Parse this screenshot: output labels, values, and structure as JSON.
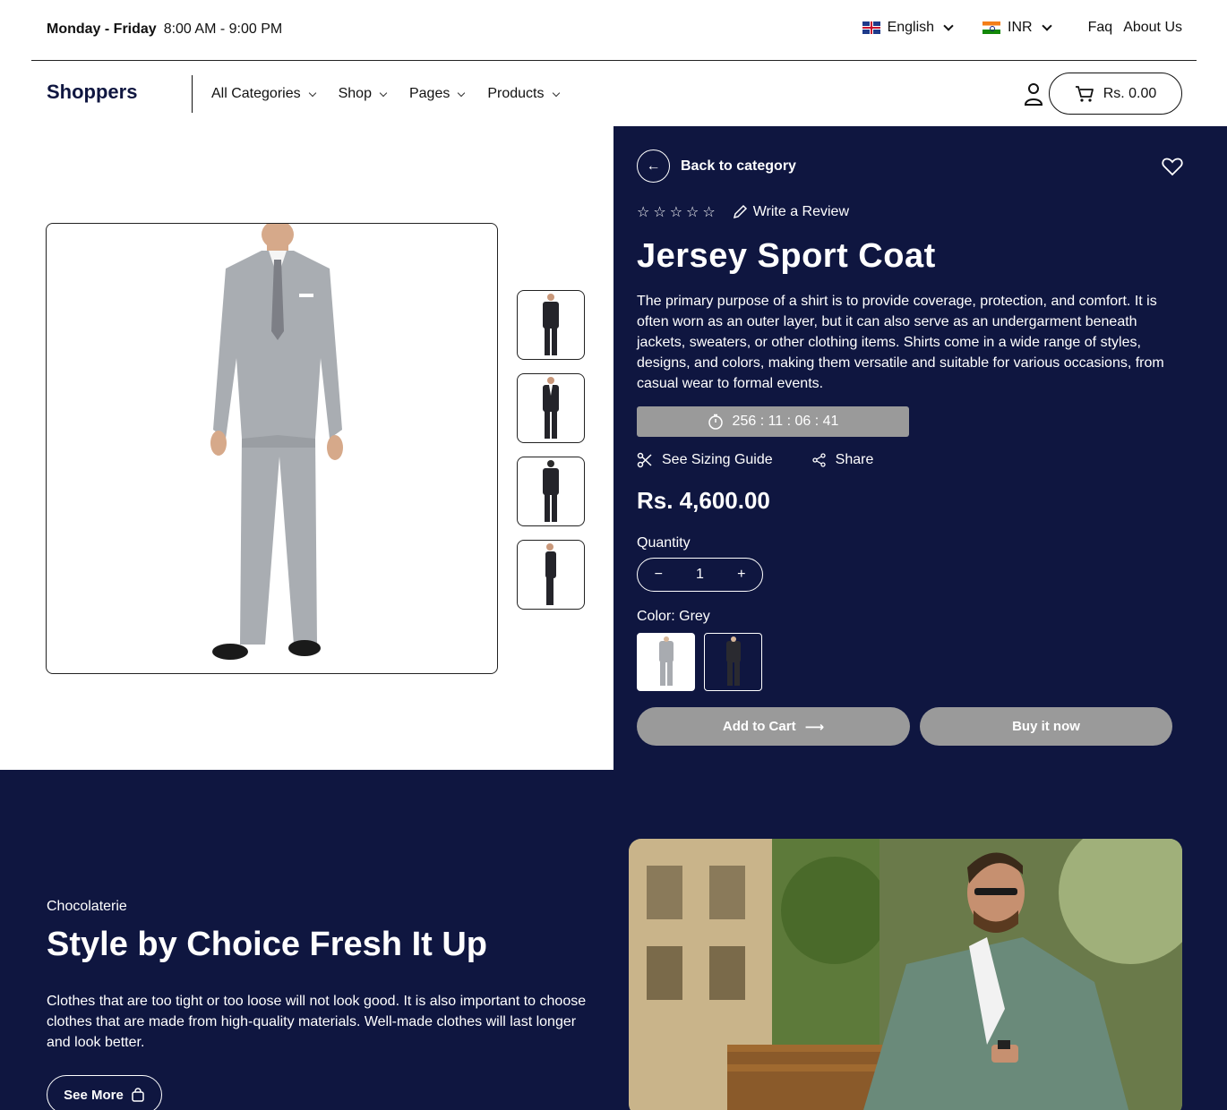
{
  "topbar": {
    "hours_days": "Monday - Friday",
    "hours_time": "8:00 AM - 9:00 PM",
    "language": "English",
    "currency": "INR",
    "faq": "Faq",
    "about": "About Us"
  },
  "nav": {
    "logo": "Shoppers",
    "menu": [
      "All Categories",
      "Shop",
      "Pages",
      "Products"
    ],
    "cart_total": "Rs. 0.00"
  },
  "product": {
    "back_label": "Back to category",
    "write_review": "Write a Review",
    "title": "Jersey Sport Coat",
    "description": "The primary purpose of a shirt is to provide coverage, protection, and comfort. It is often worn as an outer layer, but it can also serve as an undergarment beneath jackets, sweaters, or other clothing items. Shirts come in a wide range of styles, designs, and colors, making them versatile and suitable for various occasions, from casual wear to formal events.",
    "timer": "256 : 11 : 06 : 41",
    "sizing_guide": "See Sizing Guide",
    "share": "Share",
    "price": "Rs. 4,600.00",
    "quantity_label": "Quantity",
    "quantity": "1",
    "color_label": "Color: Grey",
    "add_to_cart": "Add to Cart",
    "buy_now": "Buy it now",
    "rating": 0
  },
  "promo": {
    "eyebrow": "Chocolaterie",
    "title": "Style by Choice Fresh It Up",
    "text": "Clothes that are too tight or too loose will not look good. It is also important to choose clothes that are made from high-quality materials. Well-made clothes will last longer and look better.",
    "button": "See More"
  },
  "colors": {
    "navy": "#0f1640",
    "button_grey": "#9a9a9a"
  }
}
